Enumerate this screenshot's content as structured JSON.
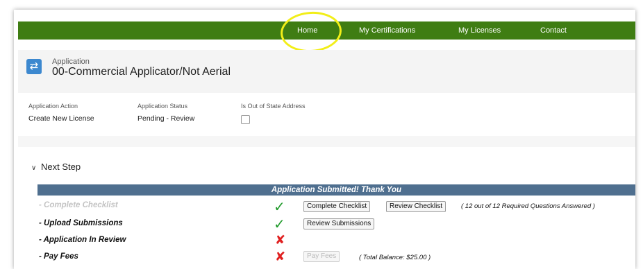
{
  "nav": {
    "items": [
      "Home",
      "My Certifications",
      "My Licenses",
      "Contact"
    ]
  },
  "header": {
    "label": "Application",
    "title": "00-Commercial Applicator/Not Aerial",
    "icon": "application-icon"
  },
  "fields": {
    "action_label": "Application Action",
    "action_value": "Create New License",
    "status_label": "Application Status",
    "status_value": "Pending - Review",
    "out_of_state_label": "Is Out of State Address",
    "out_of_state_checked": false
  },
  "next_step": {
    "label": "Next Step"
  },
  "steps_table": {
    "header": "Application Submitted! Thank You",
    "rows": [
      {
        "label": "- Complete Checklist",
        "status": "check",
        "muted": true
      },
      {
        "label": "- Upload Submissions",
        "status": "check",
        "muted": false
      },
      {
        "label": "- Application In Review",
        "status": "x",
        "muted": false
      },
      {
        "label": "- Pay Fees",
        "status": "x",
        "muted": false
      }
    ],
    "buttons": {
      "complete_checklist": "Complete Checklist",
      "review_checklist": "Review Checklist",
      "review_submissions": "Review Submissions",
      "pay_fees": "Pay Fees"
    },
    "notes": {
      "questions_answered": "( 12 out of  12  Required Questions Answered )",
      "total_balance": "( Total Balance: $25.00 )"
    }
  },
  "colors": {
    "nav_bg": "#3f7d13",
    "table_header_bg": "#4f6f8f",
    "highlight": "#f2ee18",
    "check": "#1f9a2a",
    "x_mark": "#e02020",
    "icon_bg": "#3c88cf"
  }
}
